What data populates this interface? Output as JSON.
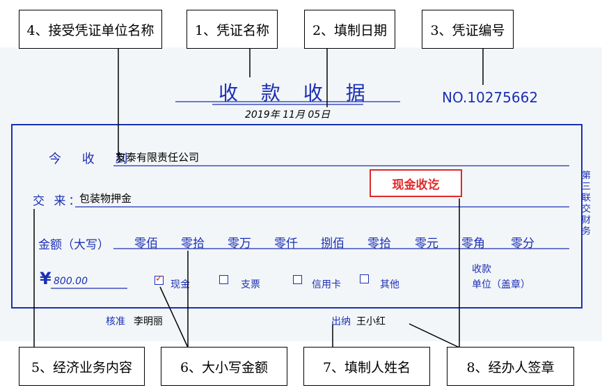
{
  "callouts": {
    "receiving_unit_name": "4、接受凭证单位名称",
    "voucher_name": "1、凭证名称",
    "fill_date": "2、填制日期",
    "voucher_number": "3、凭证编号",
    "business_content": "5、经济业务内容",
    "amount_in_words_figures": "6、大小写金额",
    "preparer_name": "7、填制人姓名",
    "handler_stamp": "8、经办人签章"
  },
  "receipt": {
    "title": "收 款 收 据",
    "date": "2019年 11月 05日",
    "number": "NO.10275662",
    "received_from_label": "今 收 到",
    "received_from_value": "友泰有限责任公司",
    "purpose_label": "交 来：",
    "purpose_value": "包装物押金",
    "amount_words_label": "金额（大写）",
    "amount_words": [
      "零佰",
      "零拾",
      "零万",
      "零仟",
      "捌佰",
      "零拾",
      "零元",
      "零角",
      "零分"
    ],
    "amount_symbol": "¥",
    "amount_figures": "800.00",
    "payment_methods": [
      {
        "label": "现金",
        "checked": true
      },
      {
        "label": "支票",
        "checked": false
      },
      {
        "label": "信用卡",
        "checked": false
      },
      {
        "label": "其他",
        "checked": false
      }
    ],
    "unit_seal_line1": "收款",
    "unit_seal_line2": "单位（盖章）",
    "side_text": "第三联交财务",
    "approver_label": "核准",
    "approver_name": "李明丽",
    "cashier_label": "出纳",
    "cashier_name": "王小红",
    "stamp_text": "现金收讫"
  },
  "colors": {
    "ink": "#1b2fb5",
    "stamp": "#e02828",
    "callout_border": "#000000"
  }
}
